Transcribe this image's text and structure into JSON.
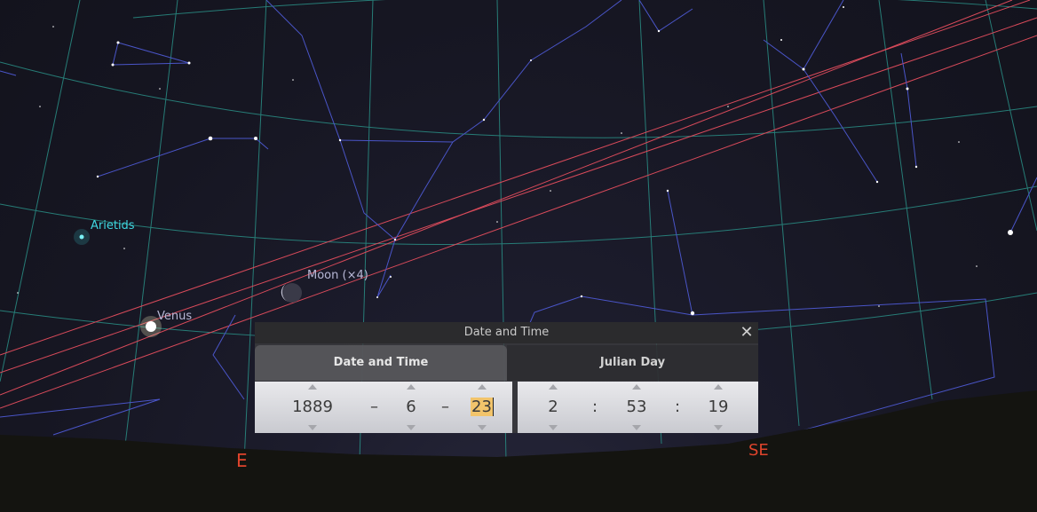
{
  "sky": {
    "labels": {
      "arietids": "Arietids",
      "moon": "Moon (×4)",
      "venus": "Venus"
    },
    "cardinals": {
      "east": "E",
      "southeast": "SE"
    },
    "colors": {
      "grid": "#2f9e8f",
      "ecliptic": "#d84a5a",
      "constellation": "#4a55c8",
      "meteor_label": "#3fd6e0",
      "cardinal": "#e0442c"
    }
  },
  "dialog": {
    "title": "Date and Time",
    "close_icon": "close-icon",
    "tabs": [
      {
        "label": "Date and Time",
        "active": true
      },
      {
        "label": "Julian Day",
        "active": false
      }
    ],
    "date": {
      "year": "1889",
      "month": "6",
      "day": "23",
      "separator": "–"
    },
    "time": {
      "hour": "2",
      "minute": "53",
      "second": "19",
      "separator": ":"
    }
  }
}
